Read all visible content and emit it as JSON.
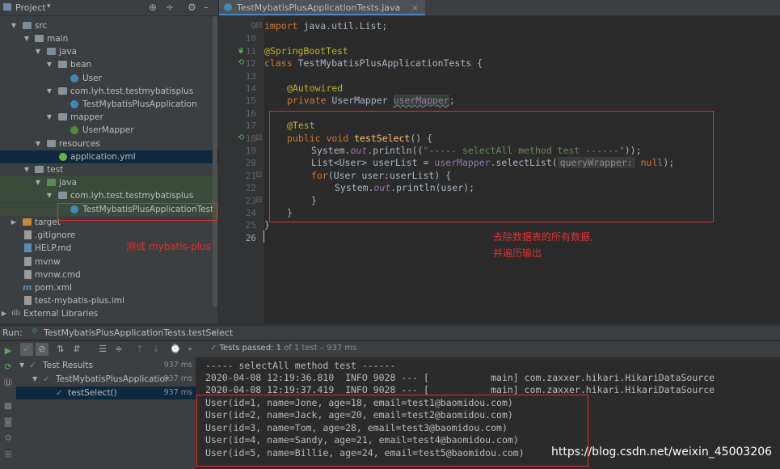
{
  "project": {
    "title": "Project",
    "tree": [
      {
        "label": "src"
      },
      {
        "label": "main"
      },
      {
        "label": "java"
      },
      {
        "label": "bean"
      },
      {
        "label": "User"
      },
      {
        "label": "com.lyh.test.testmybatisplus"
      },
      {
        "label": "TestMybatisPlusApplication"
      },
      {
        "label": "mapper"
      },
      {
        "label": "UserMapper"
      },
      {
        "label": "resources"
      },
      {
        "label": "application.yml"
      },
      {
        "label": "test"
      },
      {
        "label": "java"
      },
      {
        "label": "com.lyh.test.testmybatisplus"
      },
      {
        "label": "TestMybatisPlusApplicationTests"
      },
      {
        "label": "target"
      },
      {
        "label": ".gitignore"
      },
      {
        "label": "HELP.md"
      },
      {
        "label": "mvnw"
      },
      {
        "label": "mvnw.cmd"
      },
      {
        "label": "pom.xml"
      },
      {
        "label": "test-mybatis-plus.iml"
      },
      {
        "label": "External Libraries"
      }
    ],
    "annotation": "测试 mybatis-plus"
  },
  "editor": {
    "tab_label": "TestMybatisPlusApplicationTests.java",
    "tab_close": "×",
    "line_numbers": [
      "9",
      "10",
      "11",
      "12",
      "13",
      "14",
      "15",
      "16",
      "17",
      "18",
      "19",
      "20",
      "21",
      "22",
      "23",
      "24",
      "25",
      "26"
    ],
    "code": {
      "l9_kw": "import",
      "l9_rest": " java.util.List;",
      "l11": "@SpringBootTest",
      "l12_kw": "class",
      "l12_rest": " TestMybatisPlusApplicationTests {",
      "l14": "@Autowired",
      "l15_kw": "private",
      "l15_type": " UserMapper ",
      "l15_field": "userMapper",
      "l15_end": ";",
      "l17": "@Test",
      "l18_kw": "public void",
      "l18_fn": "testSelect",
      "l18_end": "() {",
      "l19_a": "System.",
      "l19_out": "out",
      "l19_b": ".println((",
      "l19_str": "\"----- selectAll method test ------\"",
      "l19_end": "));",
      "l20_a": "List<User> userList = ",
      "l20_field": "userMapper",
      "l20_b": ".selectList(",
      "l20_hint": "queryWrapper:",
      "l20_null": "null",
      "l20_end": ");",
      "l21_kw": "for",
      "l21_rest": "(User user:userList) {",
      "l22_a": "System.",
      "l22_out": "out",
      "l22_b": ".println(user);",
      "l23": "}",
      "l24": "}",
      "l25": "}"
    },
    "annotation_line1": "去除数据表的所有数据,",
    "annotation_line2": "并遍历输出"
  },
  "run": {
    "label": "Run:",
    "config": "TestMybatisPlusApplicationTests.testSelect",
    "tests_passed": "Tests passed:",
    "tests_count": "1",
    "tests_detail": "of 1 test – 937 ms",
    "results": [
      {
        "label": "Test Results",
        "time": "937 ms"
      },
      {
        "label": "TestMybatisPlusApplicationTe",
        "time": "937 ms"
      },
      {
        "label": "testSelect()",
        "time": "937 ms"
      }
    ],
    "console": [
      "----- selectAll method test ------",
      "2020-04-08 12:19:36.810  INFO 9028 --- [           main] com.zaxxer.hikari.HikariDataSource",
      "2020-04-08 12:19:37.419  INFO 9028 --- [           main] com.zaxxer.hikari.HikariDataSource",
      "User(id=1, name=Jone, age=18, email=test1@baomidou.com)",
      "User(id=2, name=Jack, age=20, email=test2@baomidou.com)",
      "User(id=3, name=Tom, age=28, email=test3@baomidou.com)",
      "User(id=4, name=Sandy, age=21, email=test4@baomidou.com)",
      "User(id=5, name=Billie, age=24, email=test5@baomidou.com)"
    ],
    "watermark": "https://blog.csdn.net/weixin_45003206"
  }
}
